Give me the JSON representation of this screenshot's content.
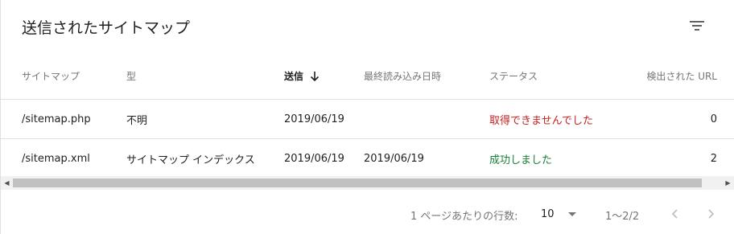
{
  "card": {
    "title": "送信されたサイトマップ",
    "filter_icon": "filter-icon"
  },
  "table": {
    "columns": [
      "サイトマップ",
      "型",
      "送信",
      "最終読み込み日時",
      "ステータス",
      "検出された URL"
    ],
    "sorted_column": "送信",
    "sort_direction": "descending",
    "rows": [
      {
        "sitemap": "/sitemap.php",
        "type": "不明",
        "sent": "2019/06/19",
        "last_read": "",
        "status": "取得できませんでした",
        "urls": "0"
      },
      {
        "sitemap": "/sitemap.xml",
        "type": "サイトマップ インデックス",
        "sent": "2019/06/19",
        "last_read": "2019/06/19",
        "status": "成功しました",
        "urls": "2"
      }
    ]
  },
  "colors": {
    "status_error": "#c5221f",
    "status_ok": "#188038"
  },
  "pagination": {
    "rows_per_page_label": "1 ページあたりの行数:",
    "rows_per_page": "10",
    "range": "1〜2/2"
  }
}
